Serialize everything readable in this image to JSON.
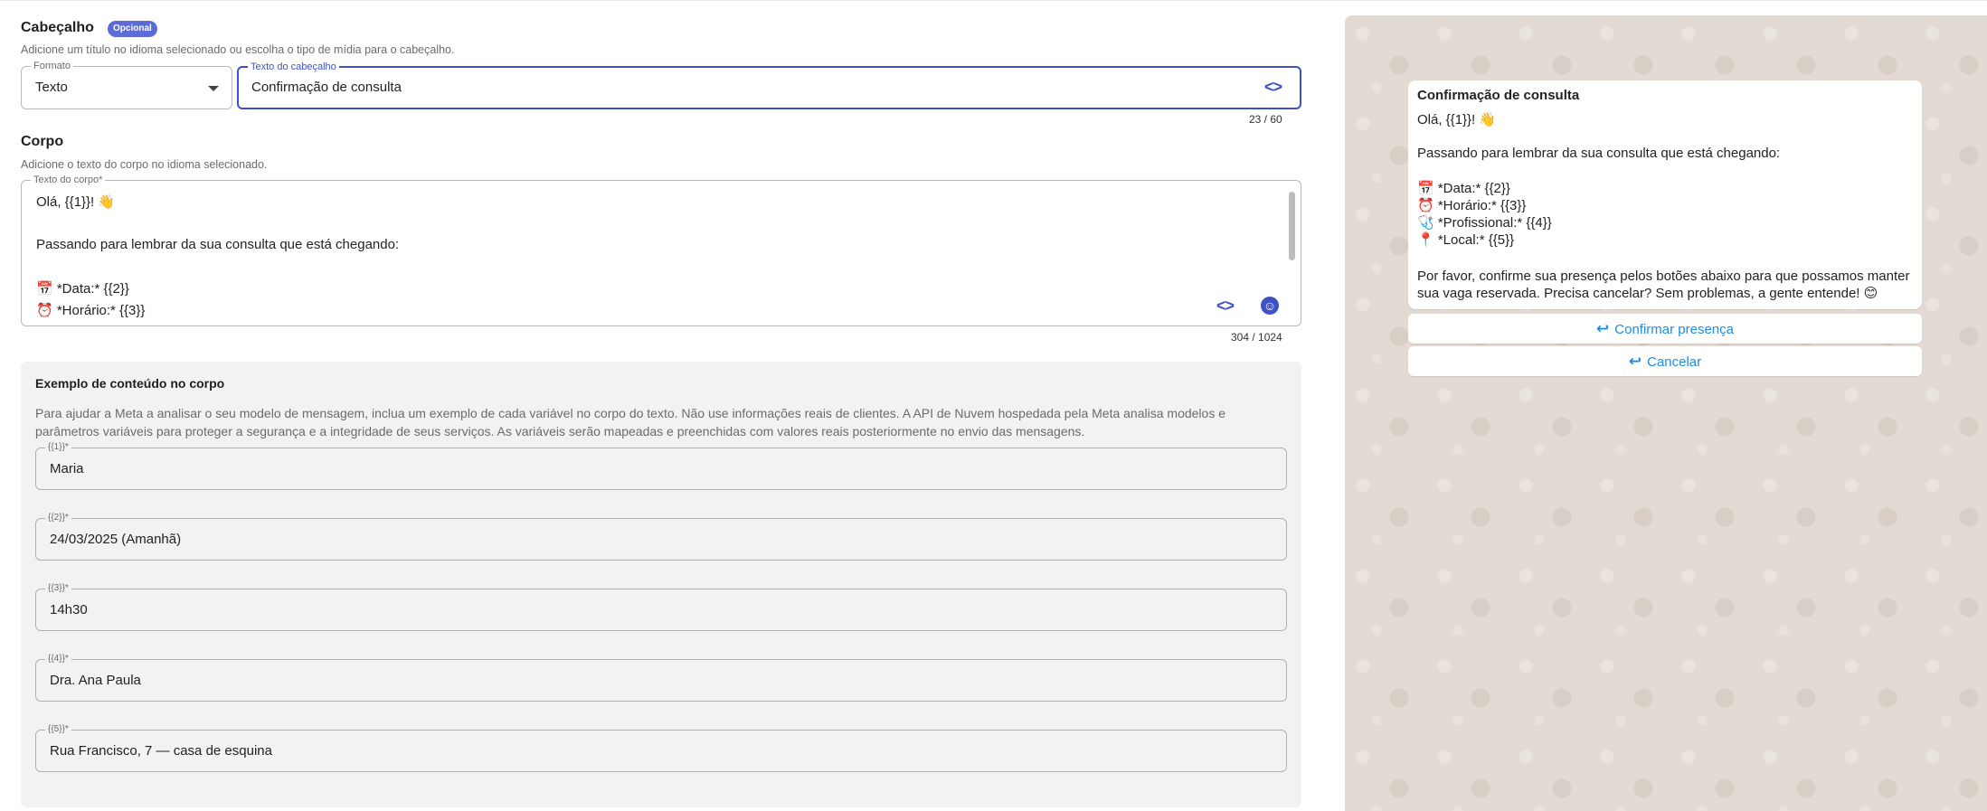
{
  "header": {
    "title": "Cabeçalho",
    "badge": "Opcional",
    "subtitle": "Adicione um título no idioma selecionado ou escolha o tipo de mídia para o cabeçalho.",
    "format_label": "Formato",
    "format_value": "Texto",
    "text_label": "Texto do cabeçalho",
    "text_value": "Confirmação de consulta",
    "counter": "23 / 60"
  },
  "body": {
    "title": "Corpo",
    "subtitle": "Adicione o texto do corpo no idioma selecionado.",
    "label": "Texto do corpo*",
    "lines": [
      "Olá, {{1}}! 👋",
      "Passando para lembrar da sua consulta que está chegando:",
      "📅 *Data:* {{2}}",
      "⏰ *Horário:* {{3}}"
    ],
    "counter": "304 / 1024"
  },
  "example": {
    "title": "Exemplo de conteúdo no corpo",
    "description": "Para ajudar a Meta a analisar o seu modelo de mensagem, inclua um exemplo de cada variável no corpo do texto. Não use informações reais de clientes. A API de Nuvem hospedada pela Meta analisa modelos e parâmetros variáveis para proteger a segurança e a integridade de seus serviços. As variáveis serão mapeadas e preenchidas com valores reais posteriormente no envio das mensagens.",
    "variables": [
      {
        "label": "{{1}}*",
        "value": "Maria"
      },
      {
        "label": "{{2}}*",
        "value": "24/03/2025 (Amanhã)"
      },
      {
        "label": "{{3}}*",
        "value": "14h30"
      },
      {
        "label": "{{4}}*",
        "value": "Dra. Ana Paula"
      },
      {
        "label": "{{5}}*",
        "value": "Rua Francisco, 7 — casa de esquina"
      }
    ]
  },
  "preview": {
    "title": "Confirmação de consulta",
    "greeting": "Olá, {{1}}! 👋",
    "intro": "Passando para lembrar da sua consulta que está chegando:",
    "details": [
      "📅 *Data:* {{2}}",
      "⏰ *Horário:* {{3}}",
      "🩺 *Profissional:* {{4}}",
      "📍 *Local:* {{5}}"
    ],
    "closing": "Por favor, confirme sua presença pelos botões abaixo para que possamos manter sua vaga reservada. Precisa cancelar? Sem problemas, a gente entende! 😊",
    "buttons": [
      "Confirmar presença",
      "Cancelar"
    ]
  },
  "icons": {
    "code": "code-brackets-icon",
    "emoji": "emoji-smile-icon",
    "reply": "reply-arrow-icon",
    "dropdown": "caret-down-icon"
  },
  "colors": {
    "accent": "#3f51c4",
    "badge": "#5b6bd8",
    "reply_button_text": "#1f8ce0",
    "preview_bg": "#e3dbd3"
  }
}
